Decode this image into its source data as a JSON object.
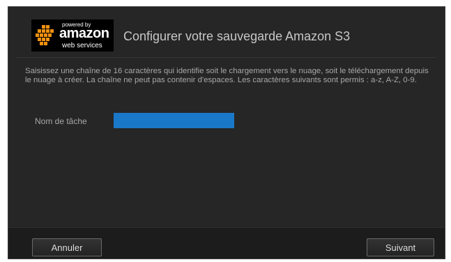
{
  "logo": {
    "powered_by": "powered by",
    "amazon": "amazon",
    "web_services": "web services"
  },
  "dialog": {
    "title": "Configurer votre sauvegarde Amazon S3",
    "description": "Saisissez une chaîne de 16 caractères qui identifie soit le chargement vers le nuage, soit le téléchargement depuis le nuage à créer. La chaîne ne peut pas contenir d'espaces. Les caractères suivants sont permis : a-z, A-Z, 0-9.",
    "task_label": "Nom de tâche",
    "task_value": ""
  },
  "footer": {
    "cancel_label": "Annuler",
    "next_label": "Suivant"
  },
  "colors": {
    "accent": "#1a78c8",
    "aws_orange": "#f29111",
    "background": "#262626"
  }
}
